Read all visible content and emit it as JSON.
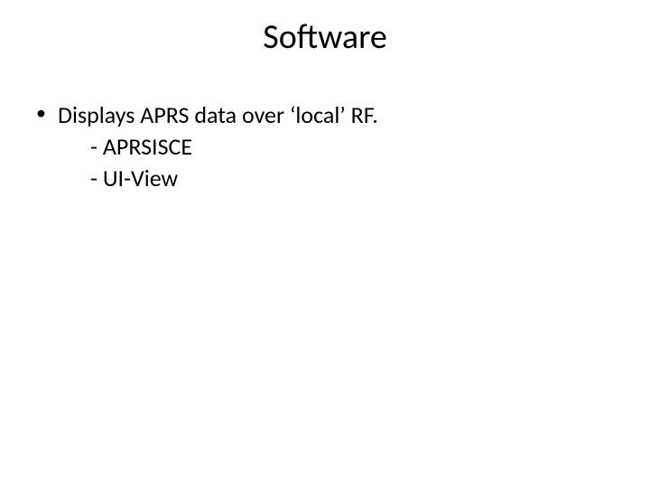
{
  "title": "Software",
  "bullet": {
    "main": "Displays APRS data over ‘local’ RF.",
    "sub1": "- APRSISCE",
    "sub2": "- UI-View"
  }
}
